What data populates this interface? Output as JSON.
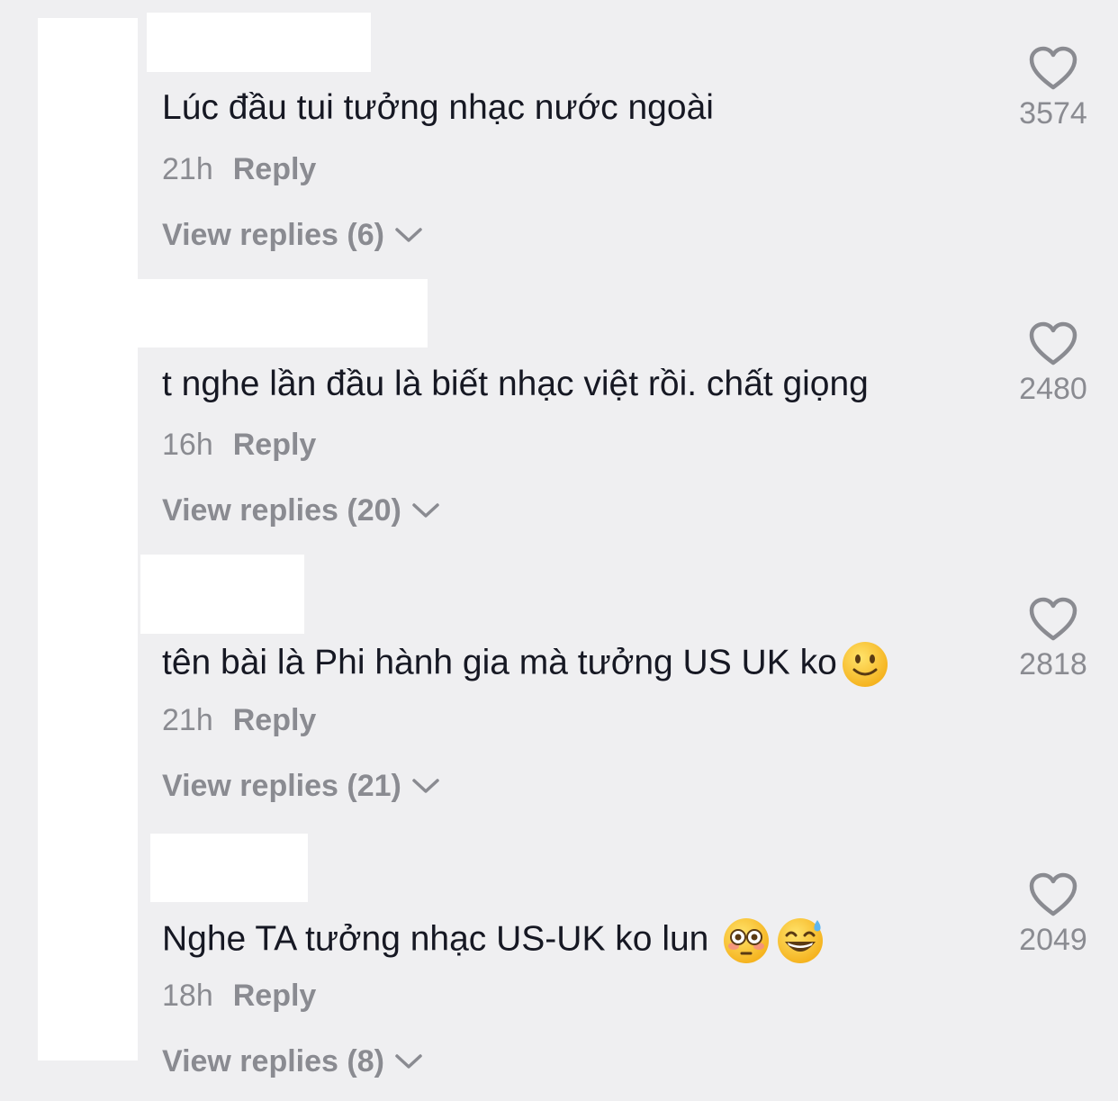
{
  "comments": [
    {
      "text": "Lúc đầu tui tưởng nhạc nước ngoài",
      "time": "21h",
      "reply": "Reply",
      "view_replies": "View replies (6)",
      "likes": "3574",
      "emojis": []
    },
    {
      "text": "t nghe lần đầu là biết nhạc việt rồi. chất giọng",
      "time": "16h",
      "reply": "Reply",
      "view_replies": "View replies (20)",
      "likes": "2480",
      "emojis": []
    },
    {
      "text": "tên bài là Phi hành gia mà tưởng US UK ko",
      "time": "21h",
      "reply": "Reply",
      "view_replies": "View replies (21)",
      "likes": "2818",
      "emojis": [
        "slightly-smiling-face"
      ]
    },
    {
      "text": "Nghe TA tưởng nhạc US-UK ko lun ",
      "time": "18h",
      "reply": "Reply",
      "view_replies": "View replies (8)",
      "likes": "2049",
      "emojis": [
        "flushed-face",
        "grinning-sweat-face"
      ]
    }
  ],
  "colors": {
    "background": "#efeff1",
    "text": "#161823",
    "muted": "#8a8b91",
    "redaction": "#ffffff"
  }
}
